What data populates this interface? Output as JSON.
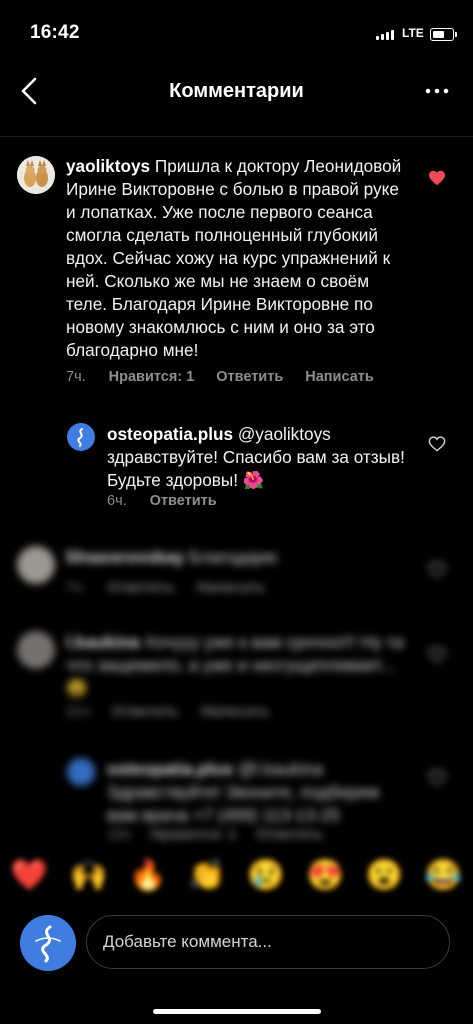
{
  "status_bar": {
    "time": "16:42",
    "network": "LTE",
    "battery_level": 0.5
  },
  "header": {
    "title": "Комментарии",
    "back_icon": "chevron-left-icon",
    "more_icon": "more-horizontal-icon"
  },
  "comments": [
    {
      "username": "yaoliktoys",
      "text": "Пришла к доктору Леонидовой Ирине Викторовне с болью в правой руке и лопатках. Уже после первого сеанса смогла сделать полноценный глубокий вдох. Сейчас хожу на курс упражнений к ней. Сколько же мы не знаем о своём теле. Благодаря Ирине Викторовне по новому знакомлюсь с ним и оно за это благодарно мне!",
      "time": "7ч.",
      "likes": "Нравится: 1",
      "reply_label": "Ответить",
      "message_label": "Написать",
      "liked": true,
      "liked_color": "#ed4956"
    },
    {
      "username": "osteopatia.plus",
      "text": "@yaoliktoys здравствуйте! Спасибо вам за отзыв! Будьте здоровы! 🌺",
      "time": "6ч.",
      "reply_label": "Ответить",
      "liked": false
    },
    {
      "username": "lilnassrovskay",
      "text": "Благодарю",
      "time": "7ч.",
      "reply_label": "Ответить",
      "message_label": "Написать",
      "blurred": true
    },
    {
      "username": "l.kaukina",
      "text": "Хочууу уже к вам срочно!!! Ну та что защемило, а уже и несгущепливает... 😩",
      "time": "21ч",
      "reply_label": "Ответить",
      "message_label": "Написать",
      "blurred": true
    },
    {
      "username": "osteopatia.plus",
      "text": "@l.kaukina Здравствуйте! Звоните, подберем вам врача +7 (499) 113-13-25",
      "time": "19ч",
      "likes": "Нравится: 1",
      "reply_label": "Ответить",
      "blurred": true
    }
  ],
  "emoji_bar": [
    "❤️",
    "🙌",
    "🔥",
    "👏",
    "😢",
    "😍",
    "😮",
    "😂"
  ],
  "composer": {
    "placeholder": "Добавьте коммента..."
  },
  "colors": {
    "background": "#000000",
    "muted_text": "#8e8e8e",
    "like_red": "#ed4956",
    "avatar_blue": "#3f7ee0"
  }
}
